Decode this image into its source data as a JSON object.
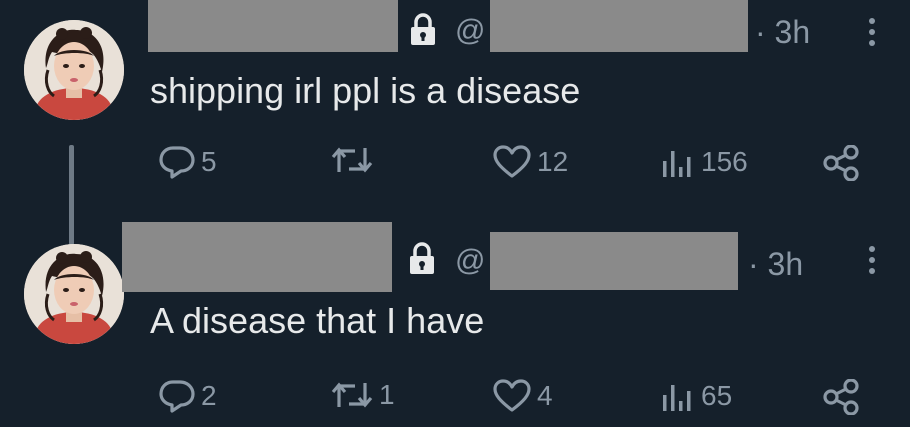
{
  "tweets": [
    {
      "at_symbol": "@",
      "time": "· 3h",
      "text": "shipping irl ppl is a disease",
      "replies": "5",
      "retweets": "",
      "likes": "12",
      "views": "156"
    },
    {
      "at_symbol": "@",
      "time": "· 3h",
      "text": "A disease that I have",
      "replies": "2",
      "retweets": "1",
      "likes": "4",
      "views": "65"
    }
  ],
  "colors": {
    "background": "#15202b",
    "text": "#e7e9ea",
    "muted": "#8b98a5",
    "redaction": "#8a8a8a"
  }
}
